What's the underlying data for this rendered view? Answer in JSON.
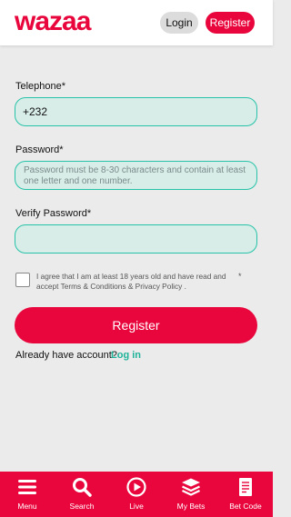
{
  "header": {
    "logo_text": "wazaa",
    "login_label": "Login",
    "register_label": "Register"
  },
  "form": {
    "telephone_label": "Telephone*",
    "telephone_value": "+232",
    "password_label": "Password*",
    "password_placeholder": "Password must be 8-30 characters and contain at least one letter and one number.",
    "verify_label": "Verify Password*",
    "verify_value": "",
    "terms_text": "I agree that I am at least 18 years old and have read and accept Terms & Conditions & Privacy Policy .",
    "terms_required_mark": "*",
    "submit_label": "Register",
    "already_text": "Already have account?",
    "login_link": "Log in"
  },
  "bottom_nav": {
    "items": [
      {
        "label": "Menu",
        "icon": "menu-icon"
      },
      {
        "label": "Search",
        "icon": "search-icon"
      },
      {
        "label": "Live",
        "icon": "live-play-icon"
      },
      {
        "label": "My Bets",
        "icon": "stack-icon"
      },
      {
        "label": "Bet Code",
        "icon": "receipt-icon"
      }
    ]
  },
  "colors": {
    "brand": "#e8063c",
    "accent": "#27c3a8",
    "link": "#1fb39a",
    "background": "#ebebeb",
    "field_fill": "#d8ede8"
  }
}
